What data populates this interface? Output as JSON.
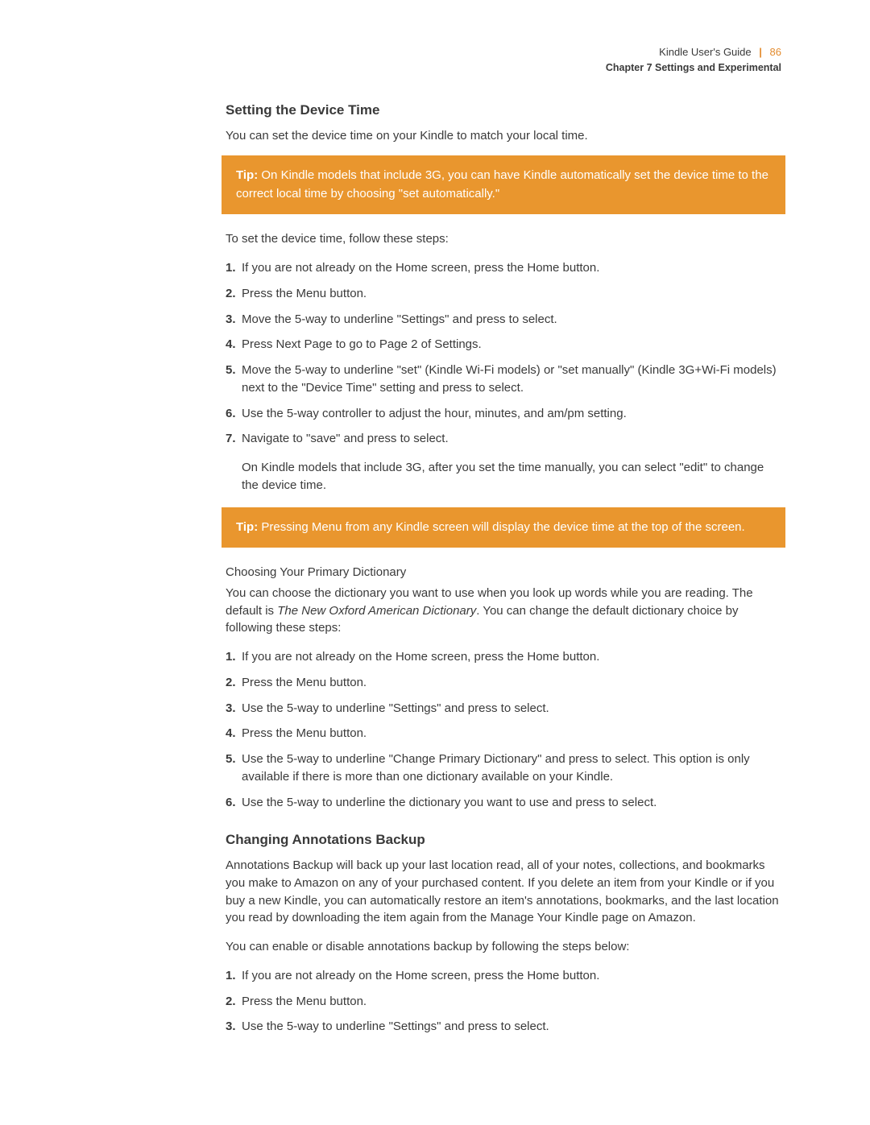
{
  "header": {
    "guide": "Kindle User's Guide",
    "pageNumber": "86",
    "chapter": "Chapter 7 Settings and Experimental"
  },
  "sections": {
    "deviceTime": {
      "title": "Setting the Device Time",
      "intro": "You can set the device time on your Kindle to match your local time.",
      "tip1": {
        "label": "Tip:",
        "body": " On Kindle models that include 3G, you can have Kindle automatically set the device time to the correct local time by choosing \"set automatically.\""
      },
      "lead": "To set the device time, follow these steps:",
      "steps": [
        "If you are not already on the Home screen, press the Home button.",
        "Press the Menu button.",
        "Move the 5-way to underline \"Settings\" and press to select.",
        "Press Next Page to go to Page 2 of Settings.",
        "Move the 5-way to underline \"set\" (Kindle Wi-Fi models) or \"set manually\" (Kindle 3G+Wi-Fi models) next to the \"Device Time\" setting and press to select.",
        "Use the 5-way controller to adjust the hour, minutes, and am/pm setting.",
        "Navigate to \"save\" and press to select."
      ],
      "afterSteps": "On Kindle models that include 3G, after you set the time manually, you can select \"edit\" to change the device time.",
      "tip2": {
        "label": "Tip:",
        "body": " Pressing Menu from any Kindle screen will display the device time at the top of the screen."
      }
    },
    "dictionary": {
      "title": "Choosing Your Primary Dictionary",
      "intro1": "You can choose the dictionary you want to use when you look up words while you are reading. The default is ",
      "introItalic": "The New Oxford American Dictionary",
      "intro2": ". You can change the default dictionary choice by following these steps:",
      "steps": [
        "If you are not already on the Home screen, press the Home button.",
        "Press the Menu button.",
        "Use the 5-way to underline \"Settings\" and press to select.",
        "Press the Menu button.",
        "Use the 5-way to underline \"Change Primary Dictionary\" and press to select. This option is only available if there is more than one dictionary available on your Kindle.",
        "Use the 5-way to underline the dictionary you want to use and press to select."
      ]
    },
    "annotations": {
      "title": "Changing Annotations Backup",
      "p1": "Annotations Backup will back up your last location read, all of your notes, collections, and bookmarks you make to Amazon on any of your purchased content. If you delete an item from your Kindle or if you buy a new Kindle, you can automatically restore an item's annotations, bookmarks, and the last location you read by downloading the item again from the Manage Your Kindle page on Amazon.",
      "p2": "You can enable or disable annotations backup by following the steps below:",
      "steps": [
        "If you are not already on the Home screen, press the Home button.",
        "Press the Menu button.",
        "Use the 5-way to underline \"Settings\" and press to select."
      ]
    }
  }
}
